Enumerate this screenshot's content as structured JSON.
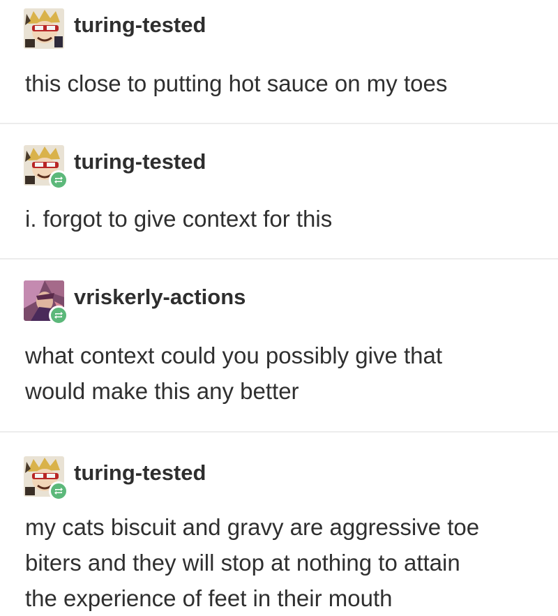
{
  "posts": [
    {
      "username": "turing-tested",
      "avatar": "turing-avatar",
      "reblog": false,
      "lines": [
        "this close to putting hot sauce on my toes"
      ]
    },
    {
      "username": "turing-tested",
      "avatar": "turing-avatar",
      "reblog": true,
      "lines": [
        "i. forgot to give context for this"
      ]
    },
    {
      "username": "vriskerly-actions",
      "avatar": "vriskerly-avatar",
      "reblog": true,
      "lines": [
        "what context could you possibly give that",
        "would make this any better"
      ]
    },
    {
      "username": "turing-tested",
      "avatar": "turing-avatar",
      "reblog": true,
      "lines": [
        "my cats biscuit and gravy are aggressive toe",
        "biters and they will stop at nothing to attain",
        "the experience of feet in their mouth"
      ]
    }
  ],
  "colors": {
    "reblog_badge": "#5cb87a",
    "divider": "#ececec",
    "text": "#2f2f2f"
  }
}
